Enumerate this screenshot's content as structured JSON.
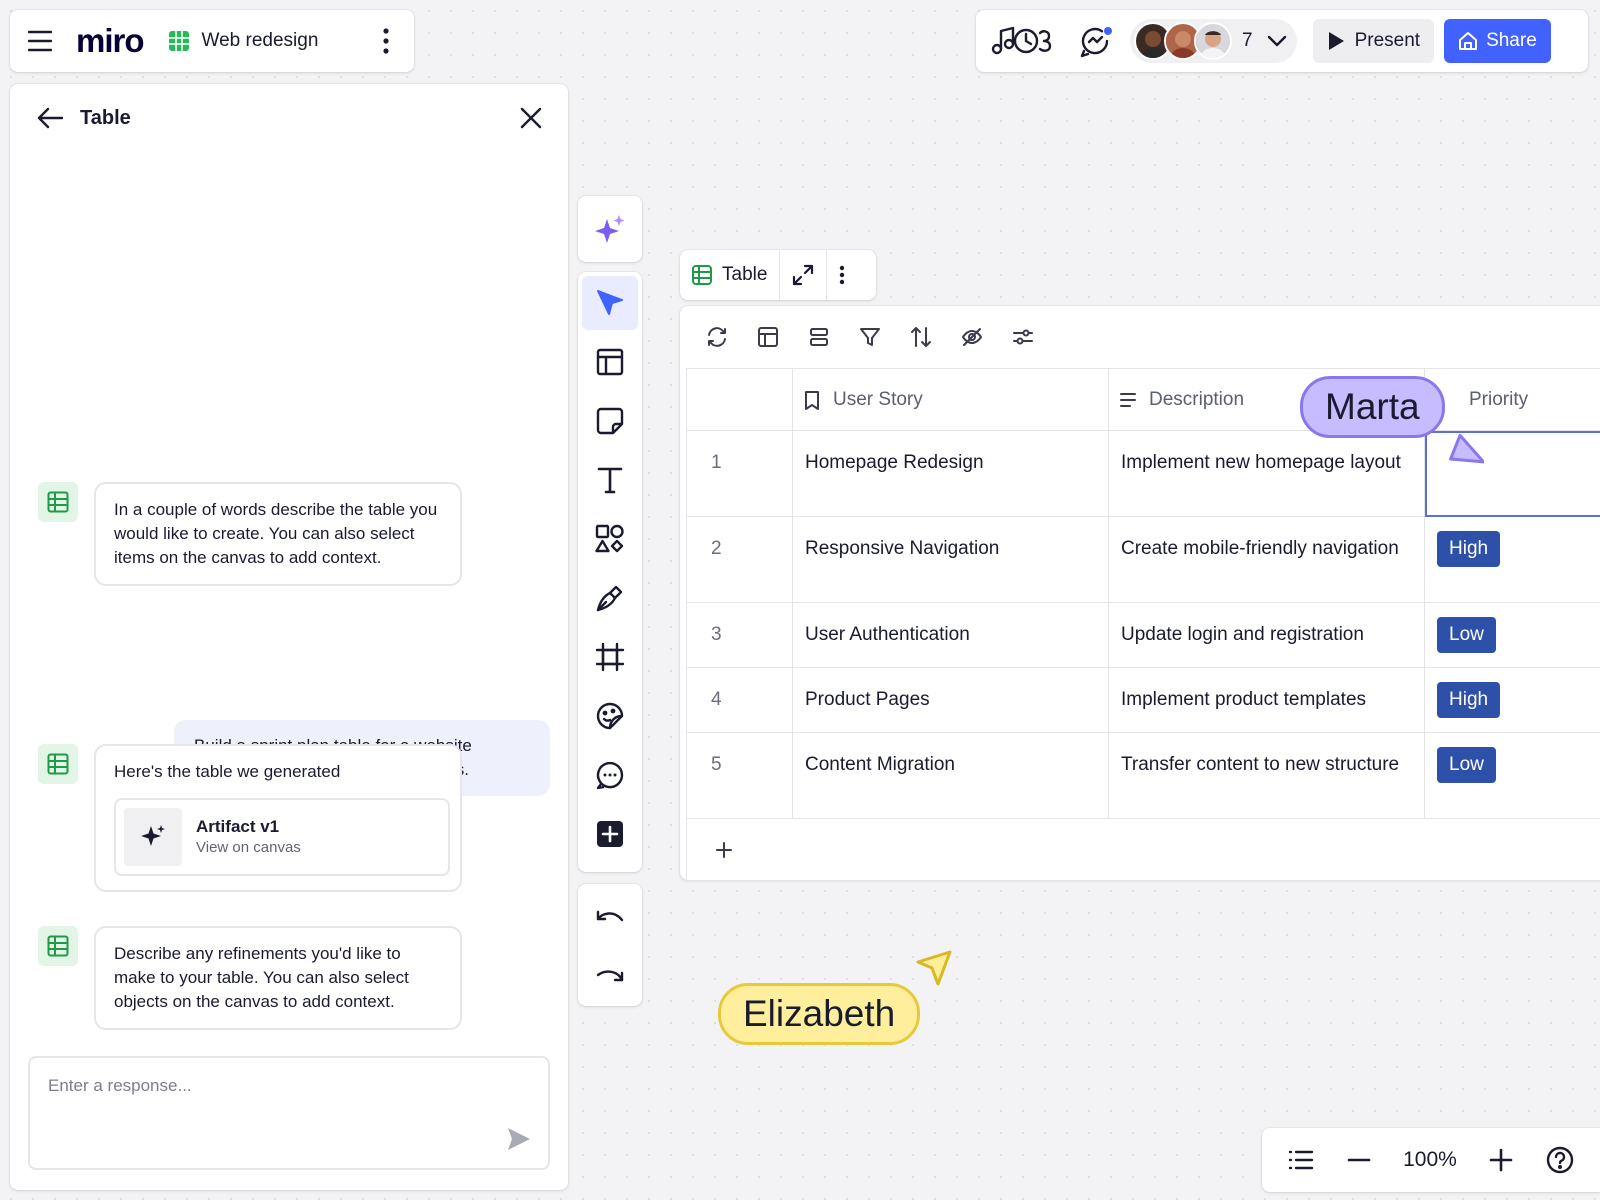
{
  "app": {
    "logo": "miro",
    "board_name": "Web redesign"
  },
  "header": {
    "collaborator_count": "7",
    "present_label": "Present",
    "share_label": "Share",
    "accent_color": "#4262ff"
  },
  "panel": {
    "title": "Table",
    "messages": [
      {
        "from": "bot",
        "text": "In a couple of words describe the table you would like to create. You can also select items on the canvas to add context."
      },
      {
        "from": "user",
        "text": "Build a sprint plan table for a website redesign with estimated story points."
      },
      {
        "from": "bot",
        "text": "Here's the table we generated"
      },
      {
        "from": "bot",
        "text": "Describe any refinements you'd like to make to your table. You can also select objects on the canvas to add context."
      }
    ],
    "artifact": {
      "title": "Artifact v1",
      "subtitle": "View on canvas"
    },
    "response_placeholder": "Enter a response..."
  },
  "toolbar": {
    "tools": [
      "ai-sparkle-icon",
      "select-icon",
      "templates-icon",
      "sticky-note-icon",
      "text-icon",
      "shapes-icon",
      "pen-icon",
      "frame-icon",
      "stickers-icon",
      "comment-icon",
      "add-more-icon"
    ],
    "active_tool": "select"
  },
  "table": {
    "title": "Table",
    "columns": [
      "User Story",
      "Description",
      "Priority"
    ],
    "rows": [
      {
        "num": "1",
        "story": "Homepage Redesign",
        "desc": "Implement new homepage layout",
        "priority": ""
      },
      {
        "num": "2",
        "story": "Responsive Navigation",
        "desc": "Create mobile-friendly navigation",
        "priority": "High"
      },
      {
        "num": "3",
        "story": "User Authentication",
        "desc": "Update login and registration",
        "priority": "Low"
      },
      {
        "num": "4",
        "story": "Product Pages",
        "desc": "Implement product templates",
        "priority": "High"
      },
      {
        "num": "5",
        "story": "Content Migration",
        "desc": "Transfer content to new structure",
        "priority": "Low"
      }
    ],
    "add_row_label": "+"
  },
  "cursors": {
    "marta": {
      "name": "Marta",
      "color": "#c6bcff"
    },
    "elizabeth": {
      "name": "Elizabeth",
      "color": "#ffef9c"
    }
  },
  "zoom": {
    "level": "100%"
  }
}
